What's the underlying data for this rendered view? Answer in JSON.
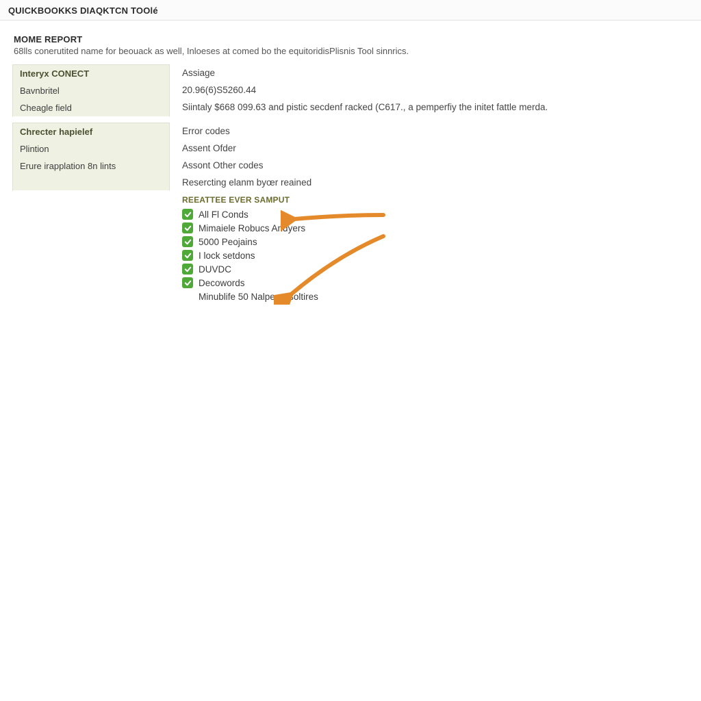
{
  "app_title": "QUICKBOOKKS DIAQKTCN TOOlé",
  "report": {
    "title": "MOME REPORT",
    "subtitle": "68lls conerutited name for beouack as well, Inloeses at comed bo the equitoridisPlisnis Tool sinnrics."
  },
  "block1": {
    "header_label": "Interyx CONECT",
    "header_value": "Assiage",
    "rows": [
      {
        "label": "Bavnbritel",
        "value": "20.96(6)S5260.44"
      },
      {
        "label": "Cheagle field",
        "value": "Siintaly $668 099.63 and pistic secdenf racked (C617., a pemperfiy the initet fattle merda."
      }
    ]
  },
  "block2": {
    "header_label": "Chrecter hapielef",
    "header_value": "Error codes",
    "rows": [
      {
        "label": "Plintion",
        "value": "Assent Ofder"
      },
      {
        "label": "Erure irapplation 8n lints",
        "value": "Assont Other codes"
      },
      {
        "label": "",
        "value": "Resercting elanm byœr reained"
      }
    ]
  },
  "checklist": {
    "title": "REEATTEE EVER SAMPUT",
    "items": [
      {
        "label": "All Fl Conds",
        "checked": true
      },
      {
        "label": "Mimaiele Robucs Andyers",
        "checked": true
      },
      {
        "label": "5000 Peojains",
        "checked": true
      },
      {
        "label": "I lock setdons",
        "checked": true
      },
      {
        "label": "DUVDC",
        "checked": true
      },
      {
        "label": "Decowords",
        "checked": true
      },
      {
        "label": "Minublife 50 Nalper resoltires",
        "checked": false
      }
    ]
  },
  "colors": {
    "check_green": "#4fa938",
    "arrow_orange": "#e58a2b"
  }
}
